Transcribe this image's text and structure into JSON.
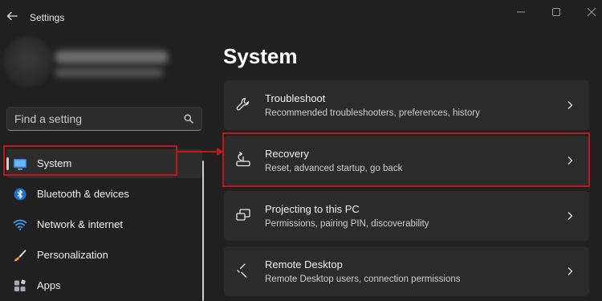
{
  "window": {
    "title": "Settings",
    "controls": [
      "minimize",
      "maximize",
      "close"
    ]
  },
  "search": {
    "placeholder": "Find a setting"
  },
  "sidebar": {
    "items": [
      {
        "label": "System",
        "icon": "monitor-icon",
        "selected": true
      },
      {
        "label": "Bluetooth & devices",
        "icon": "bluetooth-icon",
        "selected": false
      },
      {
        "label": "Network & internet",
        "icon": "wifi-icon",
        "selected": false
      },
      {
        "label": "Personalization",
        "icon": "brush-icon",
        "selected": false
      },
      {
        "label": "Apps",
        "icon": "apps-icon",
        "selected": false
      }
    ]
  },
  "main": {
    "title": "System",
    "cards": [
      {
        "title": "Troubleshoot",
        "subtitle": "Recommended troubleshooters, preferences, history",
        "icon": "wrench-icon"
      },
      {
        "title": "Recovery",
        "subtitle": "Reset, advanced startup, go back",
        "icon": "recovery-icon"
      },
      {
        "title": "Projecting to this PC",
        "subtitle": "Permissions, pairing PIN, discoverability",
        "icon": "projecting-icon"
      },
      {
        "title": "Remote Desktop",
        "subtitle": "Remote Desktop users, connection permissions",
        "icon": "remote-desktop-icon"
      }
    ]
  },
  "colors": {
    "background": "#202020",
    "card": "#2b2b2b",
    "annotation_red": "#c0161c",
    "system_icon_blue": "#2f8ae0"
  }
}
